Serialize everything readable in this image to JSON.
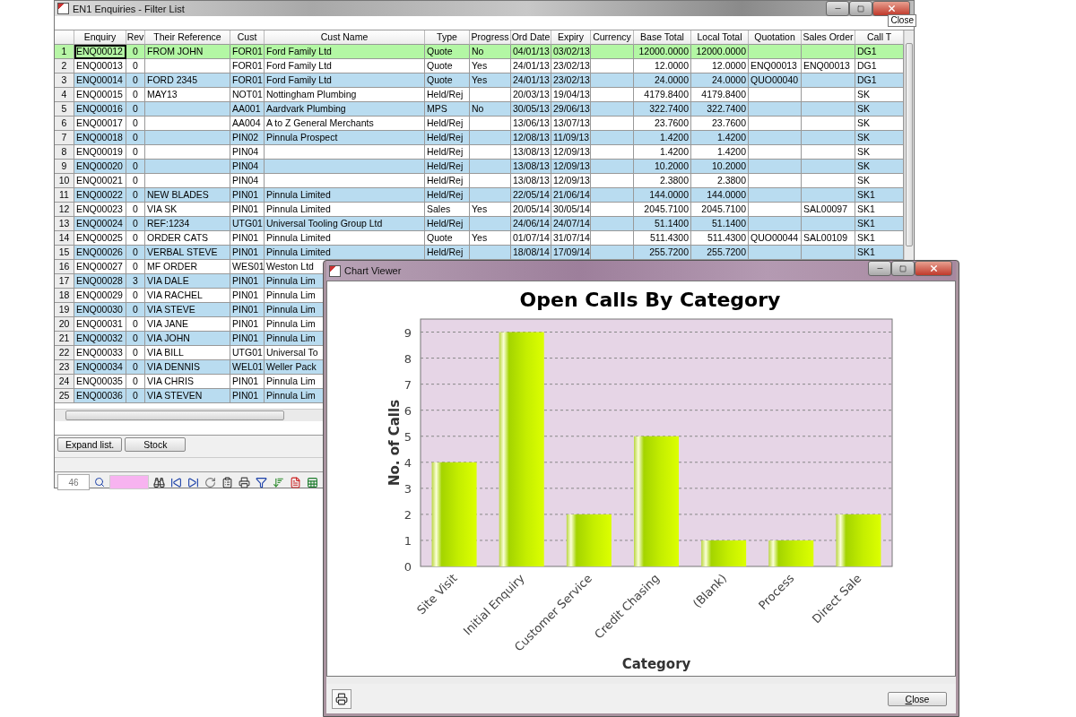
{
  "enquiries_window": {
    "title": "EN1  Enquiries - Filter List",
    "tooltip": "Close",
    "columns": [
      "Enquiry",
      "Rev",
      "Their Reference",
      "Cust",
      "Cust Name",
      "Type",
      "Progress",
      "Ord Date",
      "Expiry",
      "Currency",
      "Base Total",
      "Local Total",
      "Quotation",
      "Sales Order",
      "Call T"
    ],
    "rows": [
      {
        "number": "1",
        "selected": true,
        "cells": [
          "ENQ00012",
          "0",
          "FROM JOHN",
          "FOR01",
          "Ford Family Ltd",
          "Quote",
          "No",
          "04/01/13",
          "03/02/13",
          null,
          "12000.0000",
          "12000.0000",
          null,
          null,
          "DG1"
        ]
      },
      {
        "number": "2",
        "selected": false,
        "cells": [
          "ENQ00013",
          "0",
          null,
          "FOR01",
          "Ford Family Ltd",
          "Quote",
          "Yes",
          "24/01/13",
          "23/02/13",
          null,
          "12.0000",
          "12.0000",
          "ENQ00013",
          "ENQ00013",
          "DG1"
        ]
      },
      {
        "number": "3",
        "selected": false,
        "cells": [
          "ENQ00014",
          "0",
          "FORD 2345",
          "FOR01",
          "Ford Family Ltd",
          "Quote",
          "Yes",
          "24/01/13",
          "23/02/13",
          null,
          "24.0000",
          "24.0000",
          "QUO00040",
          null,
          "DG1"
        ]
      },
      {
        "number": "4",
        "selected": false,
        "cells": [
          "ENQ00015",
          "0",
          "MAY13",
          "NOT01",
          "Nottingham Plumbing",
          "Held/Rej",
          null,
          "20/03/13",
          "19/04/13",
          null,
          "4179.8400",
          "4179.8400",
          null,
          null,
          "SK"
        ]
      },
      {
        "number": "5",
        "selected": false,
        "cells": [
          "ENQ00016",
          "0",
          null,
          "AA001",
          "Aardvark Plumbing",
          "MPS",
          "No",
          "30/05/13",
          "29/06/13",
          null,
          "322.7400",
          "322.7400",
          null,
          null,
          "SK"
        ]
      },
      {
        "number": "6",
        "selected": false,
        "cells": [
          "ENQ00017",
          "0",
          null,
          "AA004",
          "A to Z General Merchants",
          "Held/Rej",
          null,
          "13/06/13",
          "13/07/13",
          null,
          "23.7600",
          "23.7600",
          null,
          null,
          "SK"
        ]
      },
      {
        "number": "7",
        "selected": false,
        "cells": [
          "ENQ00018",
          "0",
          null,
          "PIN02",
          "Pinnula Prospect",
          "Held/Rej",
          null,
          "12/08/13",
          "11/09/13",
          null,
          "1.4200",
          "1.4200",
          null,
          null,
          "SK"
        ]
      },
      {
        "number": "8",
        "selected": false,
        "cells": [
          "ENQ00019",
          "0",
          null,
          "PIN04",
          null,
          "Held/Rej",
          null,
          "13/08/13",
          "12/09/13",
          null,
          "1.4200",
          "1.4200",
          null,
          null,
          "SK"
        ]
      },
      {
        "number": "9",
        "selected": false,
        "cells": [
          "ENQ00020",
          "0",
          null,
          "PIN04",
          null,
          "Held/Rej",
          null,
          "13/08/13",
          "12/09/13",
          null,
          "10.2000",
          "10.2000",
          null,
          null,
          "SK"
        ]
      },
      {
        "number": "10",
        "selected": false,
        "cells": [
          "ENQ00021",
          "0",
          null,
          "PIN04",
          null,
          "Held/Rej",
          null,
          "13/08/13",
          "12/09/13",
          null,
          "2.3800",
          "2.3800",
          null,
          null,
          "SK"
        ]
      },
      {
        "number": "11",
        "selected": false,
        "cells": [
          "ENQ00022",
          "0",
          "NEW BLADES",
          "PIN01",
          "Pinnula Limited",
          "Held/Rej",
          null,
          "22/05/14",
          "21/06/14",
          null,
          "144.0000",
          "144.0000",
          null,
          null,
          "SK1"
        ]
      },
      {
        "number": "12",
        "selected": false,
        "cells": [
          "ENQ00023",
          "0",
          "VIA SK",
          "PIN01",
          "Pinnula Limited",
          "Sales",
          "Yes",
          "20/05/14",
          "30/05/14",
          null,
          "2045.7100",
          "2045.7100",
          null,
          "SAL00097",
          "SK1"
        ]
      },
      {
        "number": "13",
        "selected": false,
        "cells": [
          "ENQ00024",
          "0",
          "REF:1234",
          "UTG01",
          "Universal Tooling Group Ltd",
          "Held/Rej",
          null,
          "24/06/14",
          "24/07/14",
          null,
          "51.1400",
          "51.1400",
          null,
          null,
          "SK1"
        ]
      },
      {
        "number": "14",
        "selected": false,
        "cells": [
          "ENQ00025",
          "0",
          "ORDER CATS",
          "PIN01",
          "Pinnula Limited",
          "Quote",
          "Yes",
          "01/07/14",
          "31/07/14",
          null,
          "511.4300",
          "511.4300",
          "QUO00044",
          "SAL00109",
          "SK1"
        ]
      },
      {
        "number": "15",
        "selected": false,
        "cells": [
          "ENQ00026",
          "0",
          "VERBAL STEVE",
          "PIN01",
          "Pinnula Limited",
          "Held/Rej",
          null,
          "18/08/14",
          "17/09/14",
          null,
          "255.7200",
          "255.7200",
          null,
          null,
          "SK1"
        ]
      },
      {
        "number": "16",
        "selected": false,
        "cells": [
          "ENQ00027",
          "0",
          "MF ORDER",
          "WES01",
          "Weston Ltd"
        ]
      },
      {
        "number": "17",
        "selected": false,
        "cells": [
          "ENQ00028",
          "3",
          "VIA DALE",
          "PIN01",
          "Pinnula Lim"
        ]
      },
      {
        "number": "18",
        "selected": false,
        "cells": [
          "ENQ00029",
          "0",
          "VIA RACHEL",
          "PIN01",
          "Pinnula Lim"
        ]
      },
      {
        "number": "19",
        "selected": false,
        "cells": [
          "ENQ00030",
          "0",
          "VIA STEVE",
          "PIN01",
          "Pinnula Lim"
        ]
      },
      {
        "number": "20",
        "selected": false,
        "cells": [
          "ENQ00031",
          "0",
          "VIA JANE",
          "PIN01",
          "Pinnula Lim"
        ]
      },
      {
        "number": "21",
        "selected": false,
        "cells": [
          "ENQ00032",
          "0",
          "VIA JOHN",
          "PIN01",
          "Pinnula Lim"
        ]
      },
      {
        "number": "22",
        "selected": false,
        "cells": [
          "ENQ00033",
          "0",
          "VIA BILL",
          "UTG01",
          "Universal To"
        ]
      },
      {
        "number": "23",
        "selected": false,
        "cells": [
          "ENQ00034",
          "0",
          "VIA DENNIS",
          "WEL01",
          "Weller Pack"
        ]
      },
      {
        "number": "24",
        "selected": false,
        "cells": [
          "ENQ00035",
          "0",
          "VIA CHRIS",
          "PIN01",
          "Pinnula Lim"
        ]
      },
      {
        "number": "25",
        "selected": false,
        "cells": [
          "ENQ00036",
          "0",
          "VIA STEVEN",
          "PIN01",
          "Pinnula Lim"
        ]
      }
    ],
    "buttons": [
      "Expand list.",
      "Stock"
    ],
    "record_count": "46"
  },
  "chart_window": {
    "title": "Chart Viewer",
    "close_button": "Close",
    "chart_data": {
      "type": "bar",
      "title": "Open Calls By Category",
      "xlabel": "Category",
      "ylabel": "No. of Calls",
      "categories": [
        "Site Visit",
        "Initial Enquiry",
        "Customer Service",
        "Credit Chasing",
        "(Blank)",
        "Process",
        "Direct Sale"
      ],
      "values": [
        4,
        9,
        2,
        5,
        1,
        1,
        2
      ],
      "ylim": [
        0,
        9.5
      ],
      "grid": true,
      "yticks": [
        0,
        1,
        2,
        3,
        4,
        5,
        6,
        7,
        8,
        9
      ]
    }
  }
}
